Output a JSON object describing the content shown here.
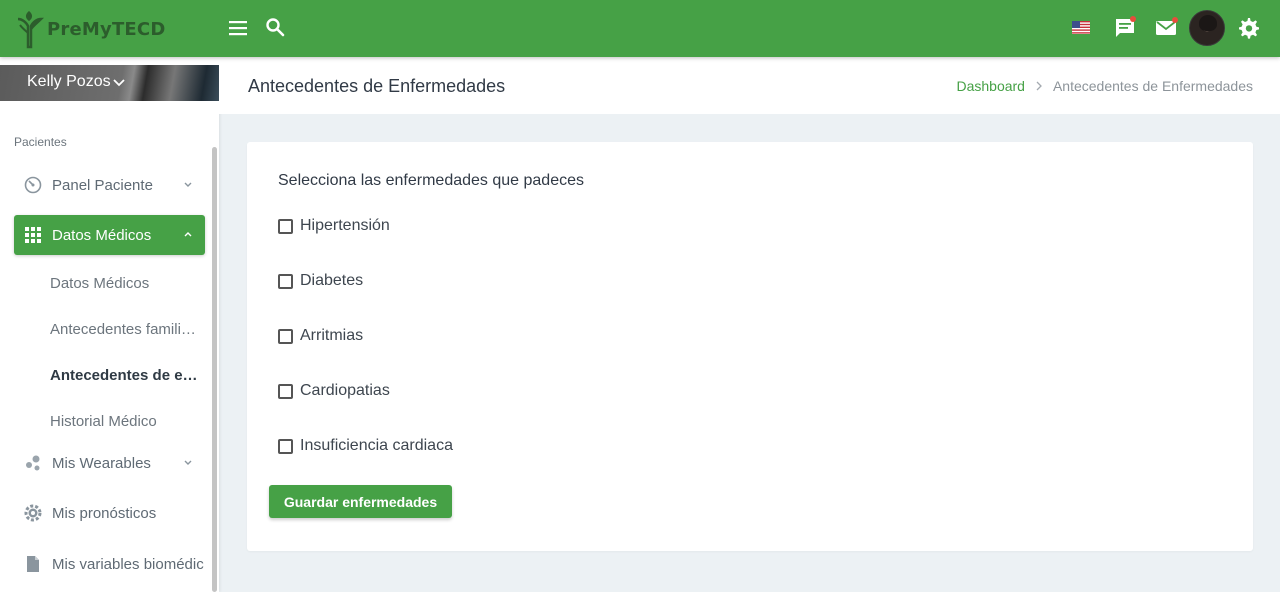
{
  "colors": {
    "brand_green": "#46a146",
    "page_bg": "#ecf1f4"
  },
  "topbar": {
    "logo_text_pre": "PreMy",
    "logo_text_tec": "TECD",
    "icons": [
      "menu-icon",
      "search-icon",
      "us-flag-icon",
      "chat-icon",
      "mail-icon",
      "avatar",
      "gear-icon"
    ]
  },
  "sidebar": {
    "user_name": "Kelly Pozos",
    "section": "Pacientes",
    "items": [
      {
        "label": "Panel Paciente",
        "icon": "dashboard-icon"
      },
      {
        "label": "Datos Médicos",
        "icon": "grid-icon",
        "active": true
      },
      {
        "label": "Mis Wearables",
        "icon": "bubbles-icon"
      },
      {
        "label": "Mis pronósticos",
        "icon": "gear-icon"
      },
      {
        "label": "Mis variables biomédic",
        "icon": "file-icon"
      }
    ],
    "sub_items": [
      {
        "label": "Datos Médicos"
      },
      {
        "label": "Antecedentes famili…"
      },
      {
        "label": "Antecedentes de e…",
        "current": true
      },
      {
        "label": "Historial Médico"
      }
    ]
  },
  "header": {
    "title": "Antecedentes de Enfermedades",
    "breadcrumb": [
      "Dashboard",
      "Antecedentes de Enfermedades"
    ]
  },
  "form": {
    "title": "Selecciona las enfermedades que padeces",
    "options": [
      {
        "label": "Hipertensión",
        "checked": false
      },
      {
        "label": "Diabetes",
        "checked": false
      },
      {
        "label": "Arritmias",
        "checked": false
      },
      {
        "label": "Cardiopatias",
        "checked": false
      },
      {
        "label": "Insuficiencia cardiaca",
        "checked": false
      }
    ],
    "submit_label": "Guardar enfermedades"
  }
}
